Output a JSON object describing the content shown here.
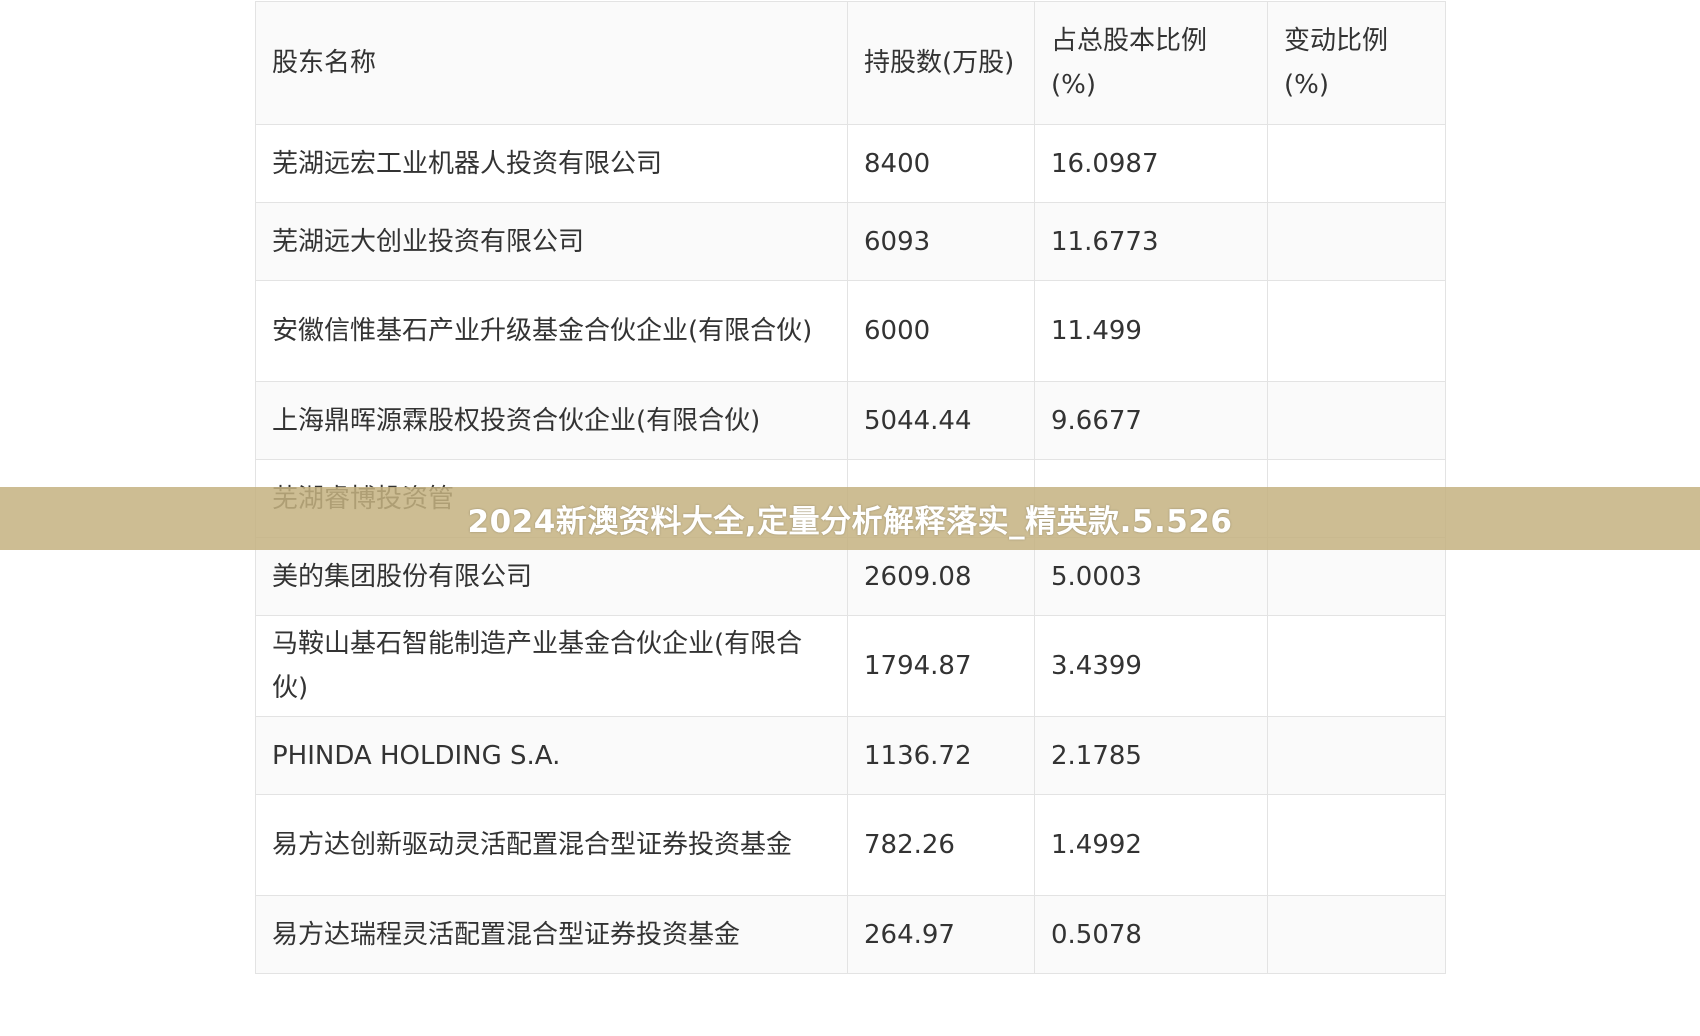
{
  "table": {
    "headers": [
      "股东名称",
      "持股数(万股)",
      "占总股本比例(%)",
      "变动比例(%)"
    ],
    "rows": [
      {
        "name": "芜湖远宏工业机器人投资有限公司",
        "shares": "8400",
        "pct": "16.0987",
        "change": ""
      },
      {
        "name": "芜湖远大创业投资有限公司",
        "shares": "6093",
        "pct": "11.6773",
        "change": ""
      },
      {
        "name": "安徽信惟基石产业升级基金合伙企业(有限合伙)",
        "shares": "6000",
        "pct": "11.499",
        "change": ""
      },
      {
        "name": "上海鼎晖源霖股权投资合伙企业(有限合伙)",
        "shares": "5044.44",
        "pct": "9.6677",
        "change": ""
      },
      {
        "name": "芜湖睿博投资管",
        "shares": "",
        "pct": "",
        "change": ""
      },
      {
        "name": "美的集团股份有限公司",
        "shares": "2609.08",
        "pct": "5.0003",
        "change": ""
      },
      {
        "name": "马鞍山基石智能制造产业基金合伙企业(有限合伙)",
        "shares": "1794.87",
        "pct": "3.4399",
        "change": ""
      },
      {
        "name": "PHINDA HOLDING S.A.",
        "shares": "1136.72",
        "pct": "2.1785",
        "change": ""
      },
      {
        "name": "易方达创新驱动灵活配置混合型证券投资基金",
        "shares": "782.26",
        "pct": "1.4992",
        "change": ""
      },
      {
        "name": "易方达瑞程灵活配置混合型证券投资基金",
        "shares": "264.97",
        "pct": "0.5078",
        "change": ""
      }
    ]
  },
  "banner": {
    "text": "2024新澳资料大全,定量分析解释落实_精英款.5.526"
  },
  "colors": {
    "banner_bg": "#c4b280",
    "banner_text": "#ffffff",
    "border": "#e3e3e3",
    "stripe": "#fafafa"
  }
}
